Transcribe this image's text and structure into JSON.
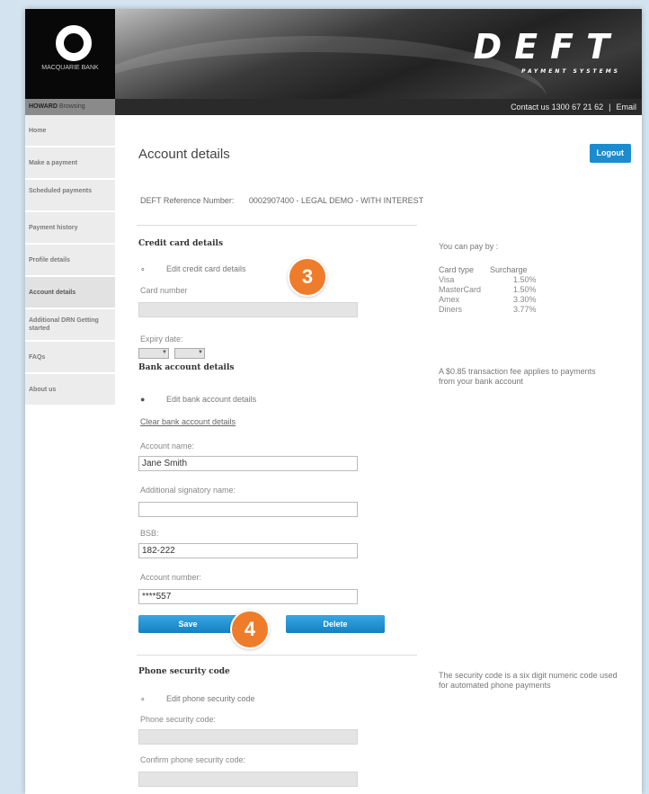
{
  "header": {
    "bank_name": "MACQUARIE BANK",
    "brand": "DEFT",
    "brand_sub": "PAYMENT SYSTEMS",
    "user_label": "HOWARD",
    "user_status": "Browsing",
    "contact": "Contact us 1300 67 21 62",
    "separator": "|",
    "email_link": "Email"
  },
  "sidebar": {
    "items": [
      {
        "label": "Home"
      },
      {
        "label": "Make a payment"
      },
      {
        "label": "Scheduled payments"
      },
      {
        "label": "Payment history"
      },
      {
        "label": "Profile details"
      },
      {
        "label": "Account details"
      },
      {
        "label": "Additional DRN Getting started"
      },
      {
        "label": "FAQs"
      },
      {
        "label": "About us"
      }
    ]
  },
  "main": {
    "title": "Account details",
    "logout_label": "Logout",
    "reference_label": "DEFT Reference Number:",
    "reference_value": "0002907400 - LEGAL DEMO - WITH INTEREST"
  },
  "credit_card": {
    "title": "Credit card details",
    "edit_label": "Edit credit card details",
    "card_number_label": "Card number",
    "expiry_label": "Expiry date:"
  },
  "bank_account": {
    "title": "Bank account details",
    "edit_label": "Edit bank account details",
    "clear_link": "Clear bank account details",
    "account_name_label": "Account name:",
    "account_name_value": "Jane Smith",
    "signatory_label": "Additional signatory name:",
    "signatory_value": "",
    "bsb_label": "BSB:",
    "bsb_value": "182-222",
    "account_number_label": "Account number:",
    "account_number_value": "****557",
    "save_label": "Save",
    "delete_label": "Delete"
  },
  "phone_security": {
    "title": "Phone security code",
    "edit_label": "Edit phone security code",
    "code_label": "Phone security code:",
    "confirm_label": "Confirm phone security code:"
  },
  "side_panel": {
    "pay_by_label": "You can pay by :",
    "table_headers": [
      "Card type",
      "Surcharge"
    ],
    "rows": [
      [
        "Visa",
        "1.50%"
      ],
      [
        "MasterCard",
        "1.50%"
      ],
      [
        "Amex",
        "3.30%"
      ],
      [
        "Diners",
        "3.77%"
      ]
    ],
    "bank_fee_note": "A $0.85 transaction fee applies to payments from your bank account",
    "security_note": "The security code is a six digit numeric code used for automated phone payments"
  },
  "callouts": {
    "step_3": "3",
    "step_4": "4"
  },
  "colors": {
    "accent_blue": "#1a8ccf",
    "callout_orange": "#ee7c2a"
  }
}
